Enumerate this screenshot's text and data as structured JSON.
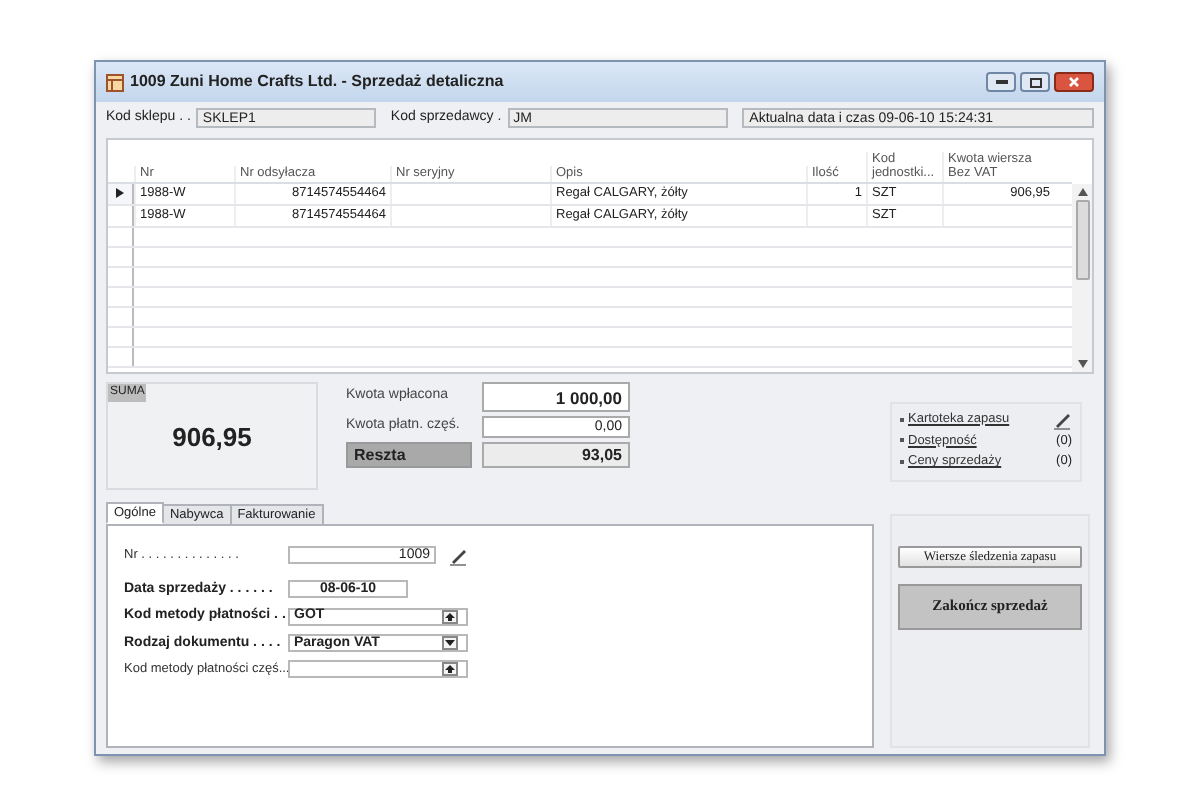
{
  "window": {
    "title": "1009 Zuni Home Crafts Ltd. - Sprzedaż detaliczna"
  },
  "header_fields": [
    {
      "label": "Kod sklepu . .",
      "value": "SKLEP1"
    },
    {
      "label": "Kod sprzedawcy .",
      "value": "JM"
    }
  ],
  "datetime": "Aktualna data i czas 09-06-10  15:24:31",
  "table": {
    "columns": [
      "Nr",
      "Nr odsyłacza",
      "Nr seryjny",
      "Opis",
      "Ilość",
      "Kod jednostki...",
      "Kwota wiersza Bez VAT"
    ],
    "rows": [
      {
        "selected": true,
        "cells": [
          "1988-W",
          "8714574554464",
          "",
          "Regał CALGARY, żółty",
          "1",
          "SZT",
          "906,95"
        ]
      },
      {
        "selected": false,
        "cells": [
          "1988-W",
          "8714574554464",
          "",
          "Regał CALGARY, żółty",
          "",
          "SZT",
          ""
        ]
      }
    ]
  },
  "totals": {
    "label": "SUMA",
    "value": "906,95"
  },
  "payments": [
    {
      "kind": "entry",
      "label": "Kwota wpłacona",
      "value": "1 000,00"
    },
    {
      "kind": "field",
      "label": "Kwota płatn. częś.",
      "value": "0,00"
    },
    {
      "kind": "result",
      "label": "Reszta",
      "value": "93,05"
    }
  ],
  "links": [
    {
      "kind": "edit",
      "label": "Kartoteka zapasu"
    },
    {
      "kind": "count",
      "label": "Dostępność",
      "count": "(0)"
    },
    {
      "kind": "count",
      "label": "Ceny sprzedaży",
      "count": "(0)"
    }
  ],
  "tabs": [
    {
      "label": "Ogólne",
      "selected": true
    },
    {
      "label": "Nabywca",
      "selected": false
    },
    {
      "label": "Fakturowanie",
      "selected": false
    }
  ],
  "form": [
    {
      "kind": "edit",
      "bold": false,
      "label": "Nr . . . . . . . . . . . . . .",
      "value": "1009"
    },
    {
      "kind": "date",
      "bold": true,
      "label": "Data sprzedaży . . . . . .",
      "value": "08-06-10"
    },
    {
      "kind": "lookup",
      "bold": true,
      "label": "Kod metody płatności . .",
      "value": "GOT"
    },
    {
      "kind": "dropdown",
      "bold": true,
      "label": "Rodzaj dokumentu . . . .",
      "value": "Paragon VAT"
    },
    {
      "kind": "lookup",
      "bold": false,
      "label": "Kod metody płatności częś..."
    }
  ],
  "buttons": [
    {
      "kind": "normal",
      "label": "Wiersze śledzenia zapasu"
    },
    {
      "kind": "primary",
      "label": "Zakończ sprzedaż"
    }
  ]
}
